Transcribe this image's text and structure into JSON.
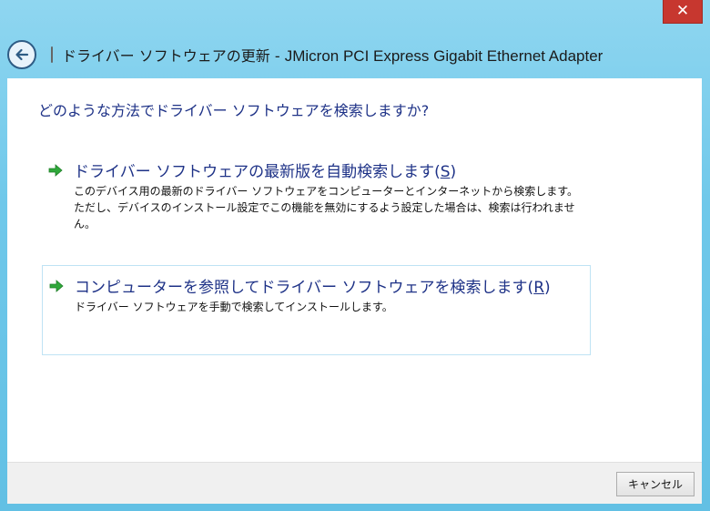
{
  "window": {
    "close_glyph": "✕",
    "title_prefix": "ドライバー ソフトウェアの更新 - ",
    "device_name": "JMicron PCI Express Gigabit Ethernet Adapter"
  },
  "main": {
    "question": "どのような方法でドライバー ソフトウェアを検索しますか?",
    "options": [
      {
        "title": "ドライバー ソフトウェアの最新版を自動検索します(",
        "accel": "S",
        "title_end": ")",
        "description": "このデバイス用の最新のドライバー ソフトウェアをコンピューターとインターネットから検索します。ただし、デバイスのインストール設定でこの機能を無効にするよう設定した場合は、検索は行われません。",
        "icon": "green-arrow-icon"
      },
      {
        "title": "コンピューターを参照してドライバー ソフトウェアを検索します(",
        "accel": "R",
        "title_end": ")",
        "description": "ドライバー ソフトウェアを手動で検索してインストールします。",
        "icon": "green-arrow-icon"
      }
    ]
  },
  "footer": {
    "cancel_label": "キャンセル"
  },
  "colors": {
    "accent_text": "#1e3287",
    "arrow": "#2fa83a",
    "close": "#c7372f"
  }
}
